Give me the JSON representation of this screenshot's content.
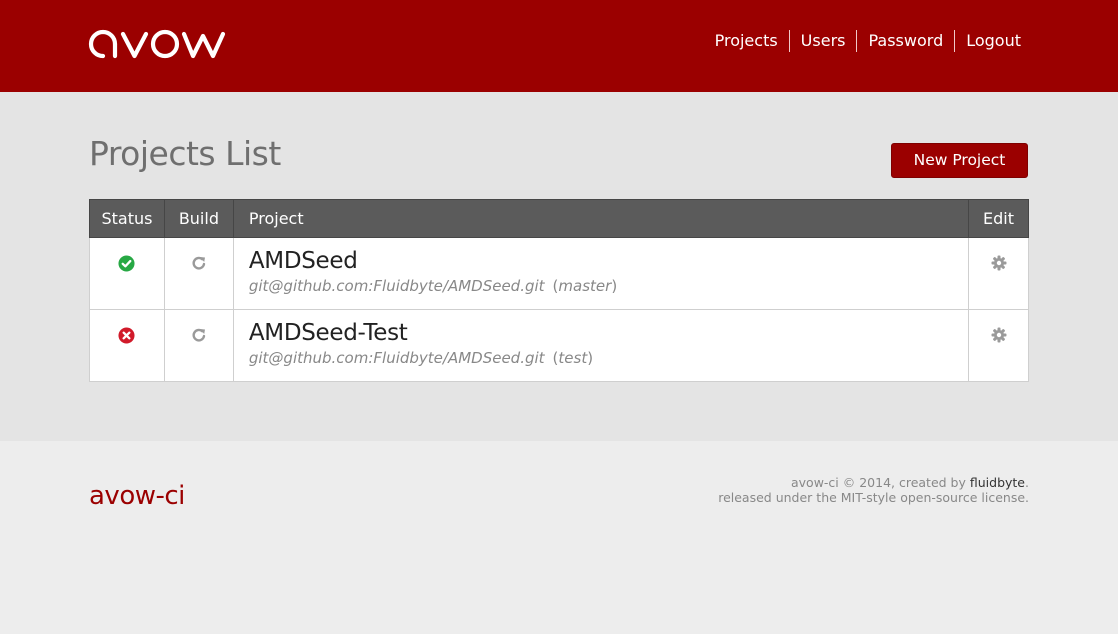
{
  "header": {
    "logo_text": "avow",
    "nav": [
      "Projects",
      "Users",
      "Password",
      "Logout"
    ]
  },
  "main": {
    "title": "Projects List",
    "new_project_label": "New Project",
    "table": {
      "headers": [
        "Status",
        "Build",
        "Project",
        "Edit"
      ],
      "rows": [
        {
          "status": "success",
          "name": "AMDSeed",
          "repo": "git@github.com:Fluidbyte/AMDSeed.git",
          "branch": "master"
        },
        {
          "status": "failure",
          "name": "AMDSeed-Test",
          "repo": "git@github.com:Fluidbyte/AMDSeed.git",
          "branch": "test"
        }
      ]
    }
  },
  "footer": {
    "brand": "avow-ci",
    "line1_prefix": "avow-ci © 2014, created by ",
    "line1_link": "fluidbyte",
    "line1_suffix": ".",
    "line2": "released under the MIT-style open-source license."
  },
  "icons": {
    "success": "check-circle-icon",
    "failure": "x-circle-icon",
    "build": "refresh-icon",
    "edit": "gear-icon"
  },
  "colors": {
    "brand": "#9b0000",
    "success": "#27a844",
    "failure": "#d11a2a",
    "table_header": "#5b5b5b"
  }
}
